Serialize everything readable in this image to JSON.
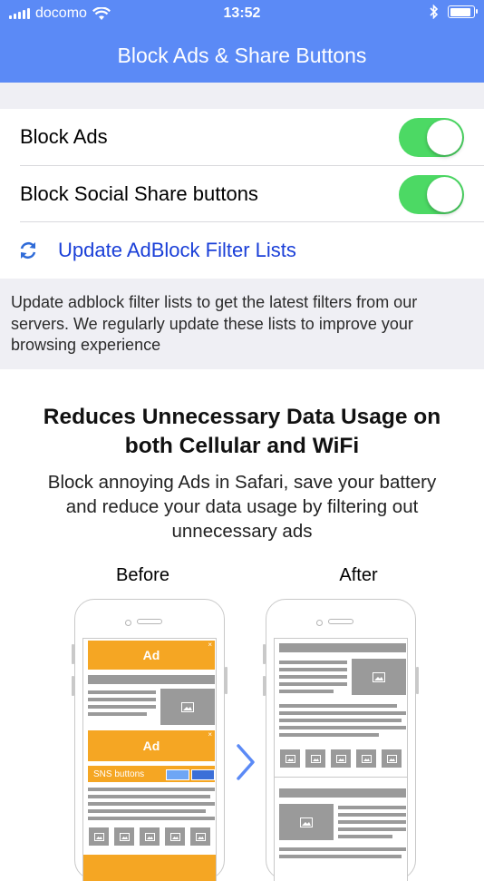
{
  "status_bar": {
    "carrier": "docomo",
    "time": "13:52"
  },
  "nav": {
    "title": "Block Ads & Share Buttons"
  },
  "settings": {
    "block_ads_label": "Block Ads",
    "block_ads_on": true,
    "block_social_label": "Block Social Share buttons",
    "block_social_on": true,
    "update_label": "Update AdBlock Filter Lists",
    "footer": "Update adblock filter lists to get the latest filters from our servers. We regularly update these lists to improve your browsing experience"
  },
  "promo": {
    "title_line1": "Reduces Unnecessary Data Usage on",
    "title_line2": "both Cellular and WiFi",
    "text_line1": "Block annoying Ads in Safari, save your battery",
    "text_line2": "and reduce your data usage by filtering out",
    "text_line3": "unnecessary ads",
    "before_label": "Before",
    "after_label": "After",
    "ad_label": "Ad",
    "sns_label": "SNS buttons"
  },
  "colors": {
    "accent": "#5b8af6",
    "toggle_on": "#4cd964",
    "link": "#1a3fd8",
    "ad": "#f5a623"
  }
}
